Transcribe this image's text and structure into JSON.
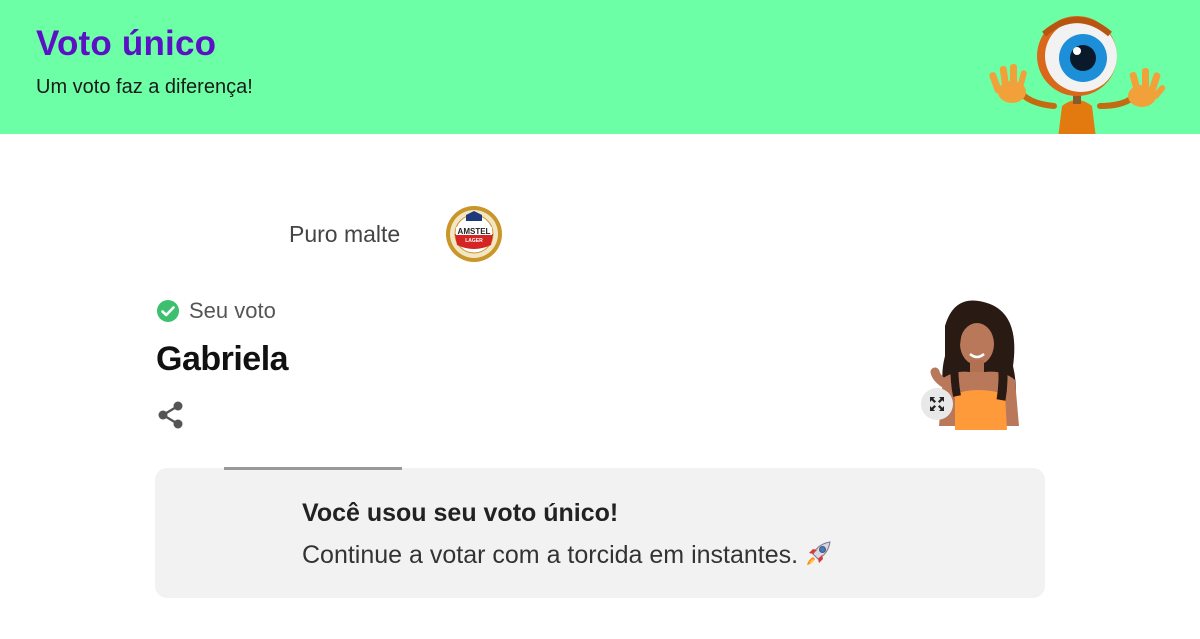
{
  "header": {
    "title": "Voto único",
    "subtitle": "Um voto faz a diferença!",
    "background_color": "#6cffa6",
    "title_color": "#5a12c4",
    "mascot_icon": "big-brother-eye-mascot"
  },
  "sponsor": {
    "label": "Puro malte",
    "logo_text_top": "AMSTEL",
    "logo_text_bottom": "LAGER"
  },
  "vote": {
    "status_label": "Seu voto",
    "status_icon": "check-circle-icon",
    "status_color": "#3cc070",
    "candidate_name": "Gabriela",
    "share_icon": "share-icon",
    "expand_icon": "expand-icon"
  },
  "info": {
    "title": "Você usou seu voto único!",
    "text": "Continue a votar com a torcida em instantes.",
    "emoji_icon": "rocket-icon",
    "progress": 1.0
  }
}
